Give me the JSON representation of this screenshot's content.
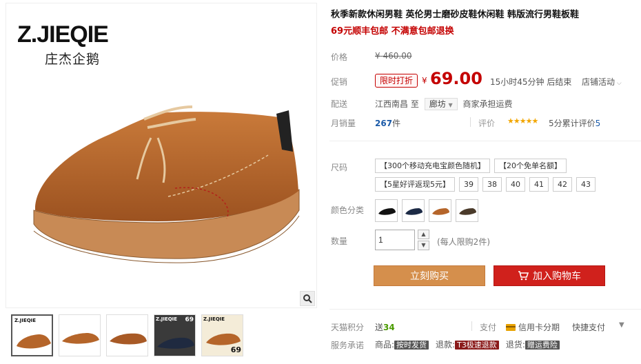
{
  "brand": {
    "logo_text": "Z.JIEQIE",
    "logo_sub": "庄杰企鹅"
  },
  "product": {
    "title": "秋季新款休闲男鞋 英伦男士磨砂皮鞋休闲鞋 韩版流行男鞋板鞋",
    "subtitle": "69元顺丰包邮 不满意包邮退换"
  },
  "price": {
    "label": "价格",
    "currency": "¥",
    "original": "460.00",
    "promo_label": "促销",
    "promo_tag": "限时打折",
    "current": "69.00",
    "countdown": "15小时45分钟 后结束",
    "store_activity": "店铺活动"
  },
  "shipping": {
    "label": "配送",
    "from": "江西南昌",
    "to_word": "至",
    "to_city": "廊坊",
    "fee": "商家承担运费"
  },
  "sales": {
    "label": "月销量",
    "count": "267",
    "unit": "件"
  },
  "reviews": {
    "label": "评价",
    "stars": "★★★★★",
    "text": "5分累计评价",
    "count": "5"
  },
  "options": {
    "size_label": "尺码",
    "sizes": [
      "【300个移动充电宝颜色随机】",
      "【20个免单名额】",
      "【5星好评返现5元】",
      "39",
      "38",
      "40",
      "41",
      "42",
      "43"
    ],
    "color_label": "颜色分类",
    "color_count": 4
  },
  "quantity": {
    "label": "数量",
    "value": "1",
    "limit": "(每人限购2件)",
    "up": "▲",
    "down": "▼"
  },
  "actions": {
    "buy": "立刻购买",
    "cart": "加入购物车"
  },
  "footer": {
    "points_label": "天猫积分",
    "points_text": "送",
    "points_value": "34",
    "pay_label": "支付",
    "credit": "信用卡分期",
    "quickpay": "快捷支付",
    "promise_label": "服务承诺",
    "p1_label": "商品:",
    "p1_badge": "按时发货",
    "p2_label": "退款:",
    "p2_badge": "T3极速退款",
    "p3_label": "退货:",
    "p3_badge": "赠运费险"
  },
  "colors": {
    "price_red": "#c40000",
    "buy_orange": "#d58f4c",
    "cart_red": "#d0211c",
    "shoe_brown": "#b5652a"
  }
}
